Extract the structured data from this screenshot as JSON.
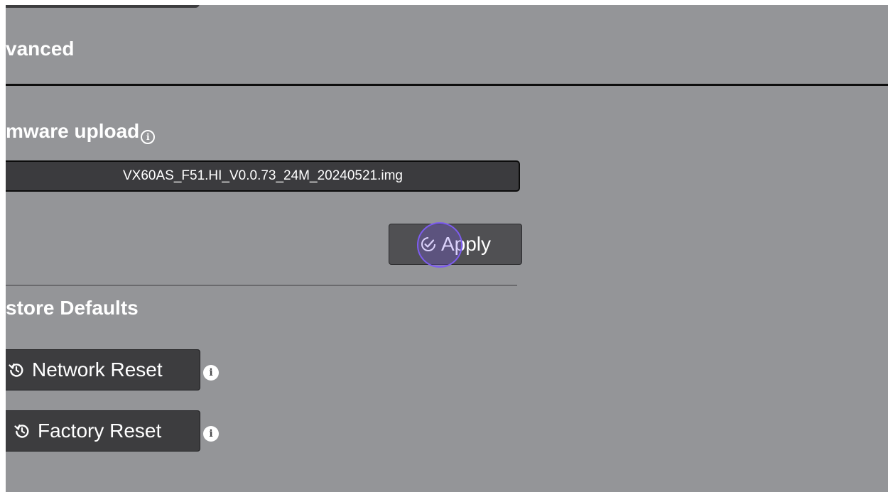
{
  "sections": {
    "advanced_title": "vanced",
    "firmware_title": "mware upload",
    "restore_title": "store Defaults"
  },
  "firmware": {
    "selected_file": "VX60AS_F51.HI_V0.0.73_24M_20240521.img",
    "apply_label": "Apply"
  },
  "restore": {
    "network_reset_label": "Network Reset",
    "factory_reset_label": "Factory Reset"
  },
  "icons": {
    "firmware_info": "info-circle-outline-icon",
    "apply": "check-circle-icon",
    "reset": "reset-history-icon",
    "network_info": "info-circle-solid-icon",
    "factory_info": "info-circle-solid-icon"
  },
  "colors": {
    "page_background": "#949598",
    "button_background": "#3d3d3f",
    "apply_button_background": "#505053",
    "click_indicator": "#7d5cf0",
    "text": "#ffffff"
  }
}
